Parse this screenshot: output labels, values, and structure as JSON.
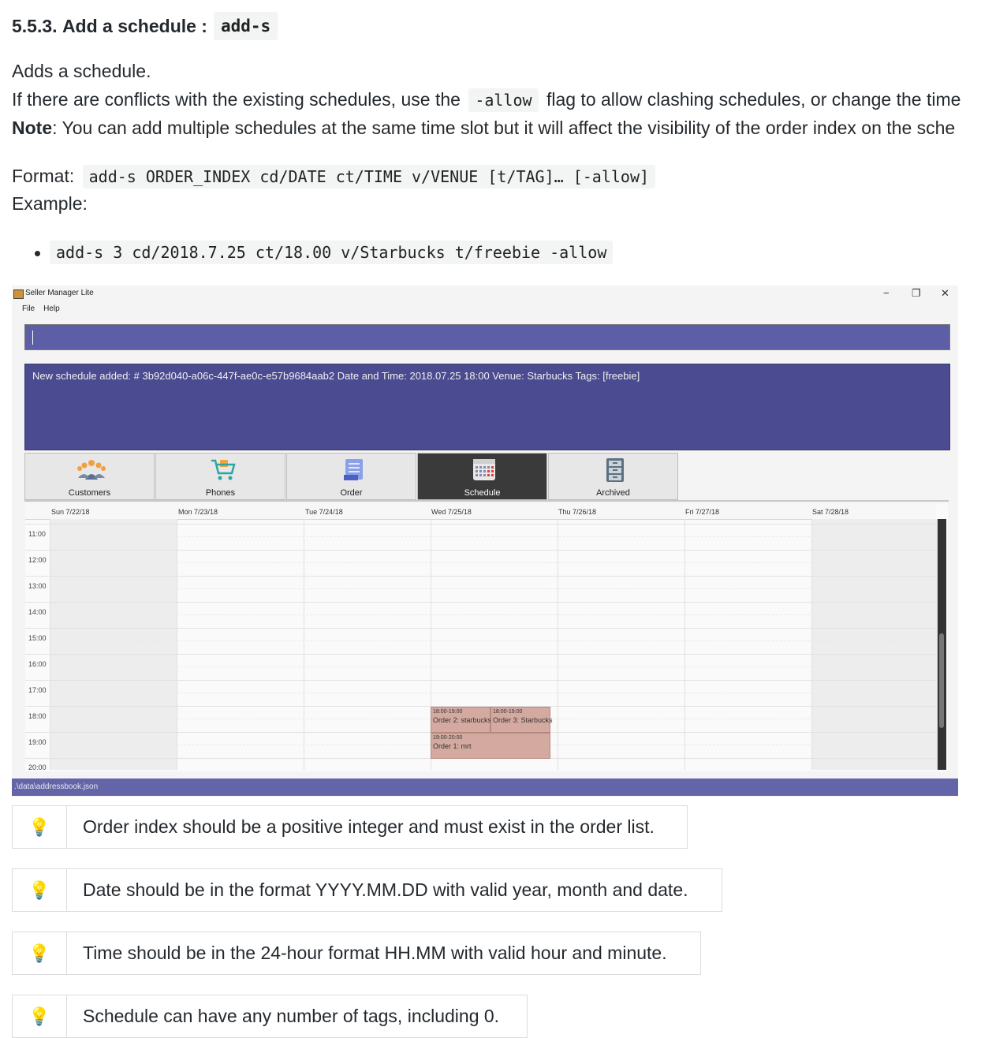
{
  "section": {
    "number": "5.5.3.",
    "title": "Add a schedule :",
    "command": "add-s"
  },
  "body": {
    "intro": "Adds a schedule.",
    "conflict_pre": "If there are conflicts with the existing schedules, use the",
    "conflict_code": "-allow",
    "conflict_post": "flag to allow clashing schedules, or change the time",
    "note_label": "Note",
    "note_text": ": You can add multiple schedules at the same time slot but it will affect the visibility of the order index on the sche",
    "format_label": "Format:",
    "format_code": "add-s ORDER_INDEX cd/DATE ct/TIME v/VENUE [t/TAG]… [-allow]",
    "example_label": "Example:",
    "example_code": "add-s 3 cd/2018.7.25 ct/18.00 v/Starbucks t/freebie -allow"
  },
  "app": {
    "title": "Seller Manager Lite",
    "menu": [
      "File",
      "Help"
    ],
    "window_buttons": [
      "−",
      "❐",
      "✕"
    ],
    "command_value": "",
    "result_text": "New schedule added:  # 3b92d040-a06c-447f-ae0c-e57b9684aab2 Date and Time: 2018.07.25 18:00 Venue: Starbucks Tags: [freebie]",
    "tabs": [
      {
        "label": "Customers",
        "icon": "customers-icon",
        "active": false
      },
      {
        "label": "Phones",
        "icon": "cart-icon",
        "active": false
      },
      {
        "label": "Order",
        "icon": "order-list-icon",
        "active": false
      },
      {
        "label": "Schedule",
        "icon": "calendar-icon",
        "active": true
      },
      {
        "label": "Archived",
        "icon": "filing-cabinet-icon",
        "active": false
      }
    ],
    "calendar": {
      "days": [
        "Sun 7/22/18",
        "Mon 7/23/18",
        "Tue 7/24/18",
        "Wed 7/25/18",
        "Thu 7/26/18",
        "Fri 7/27/18",
        "Sat 7/28/18"
      ],
      "hours": [
        "11:00",
        "12:00",
        "13:00",
        "14:00",
        "15:00",
        "16:00",
        "17:00",
        "18:00",
        "19:00",
        "20:00"
      ],
      "appointments": [
        {
          "time": "18:00-19:00",
          "desc": "Order 2: starbucks"
        },
        {
          "time": "18:00-19:00",
          "desc": "Order 3: Starbucks"
        },
        {
          "time": "19:00-20:00",
          "desc": "Order 1: mrt"
        }
      ]
    },
    "status_path": ".\\data\\addressbook.json"
  },
  "tips": [
    {
      "icon": "💡",
      "text": "Order index should be a positive integer and must exist in the order list."
    },
    {
      "icon": "💡",
      "text": "Date should be in the format YYYY.MM.DD with valid year, month and date."
    },
    {
      "icon": "💡",
      "text": "Time should be in the 24-hour format HH.MM with valid hour and minute."
    },
    {
      "icon": "💡",
      "text": "Schedule can have any number of tags, including 0."
    }
  ]
}
